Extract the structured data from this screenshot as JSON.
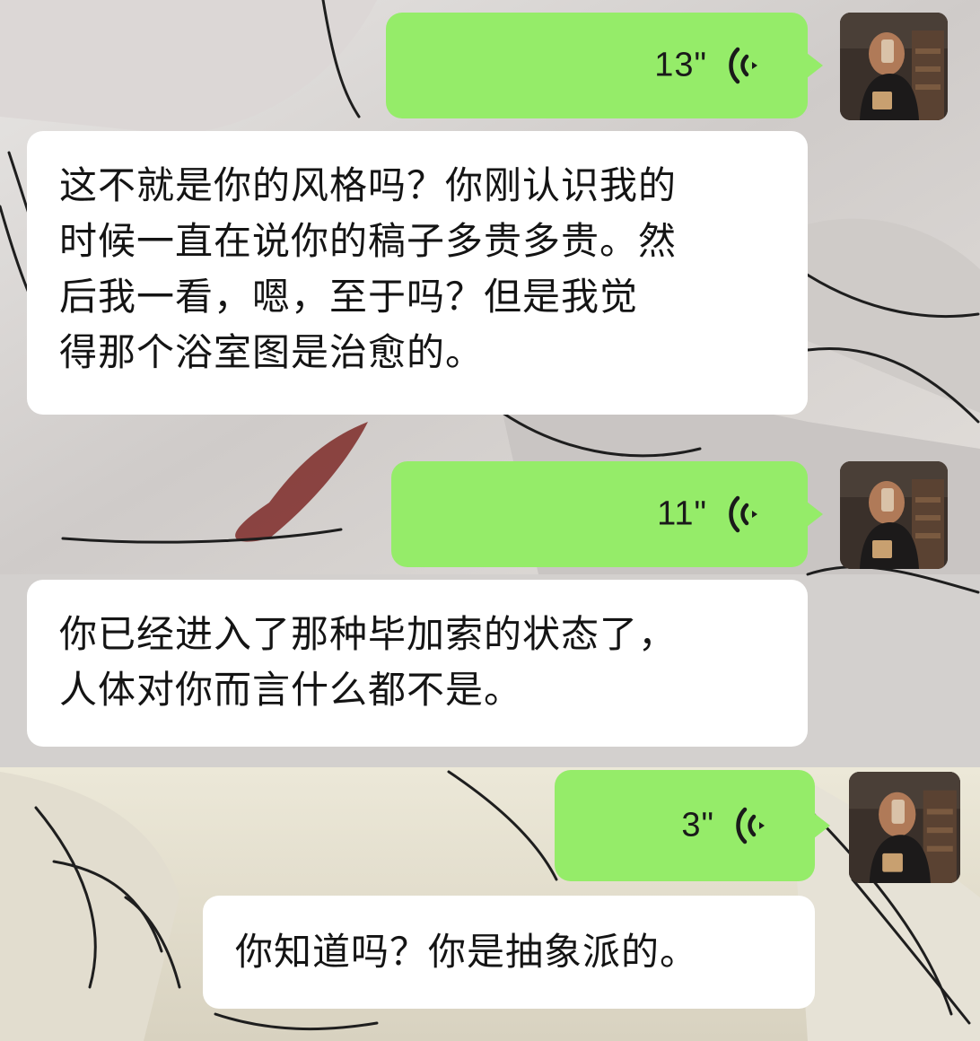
{
  "messages": [
    {
      "type": "voice",
      "side": "right",
      "duration": "13\"",
      "icon": "voice-wave-icon"
    },
    {
      "type": "text",
      "side": "left",
      "lines": [
        "这不就是你的风格吗？你刚认识我的",
        "时候一直在说你的稿子多贵多贵。然",
        "后我一看，嗯，至于吗？但是我觉",
        "得那个浴室图是治愈的。"
      ]
    },
    {
      "type": "voice",
      "side": "right",
      "duration": "11\"",
      "icon": "voice-wave-icon"
    },
    {
      "type": "text",
      "side": "left",
      "lines": [
        "你已经进入了那种毕加索的状态了，",
        "人体对你而言什么都不是。"
      ]
    },
    {
      "type": "voice",
      "side": "right",
      "duration": "3\"",
      "icon": "voice-wave-icon"
    },
    {
      "type": "text",
      "side": "left",
      "lines": [
        "你知道吗？你是抽象派的。"
      ]
    }
  ],
  "colors": {
    "voice_bubble": "#95ec69",
    "text_bubble": "#ffffff",
    "text": "#141414"
  }
}
